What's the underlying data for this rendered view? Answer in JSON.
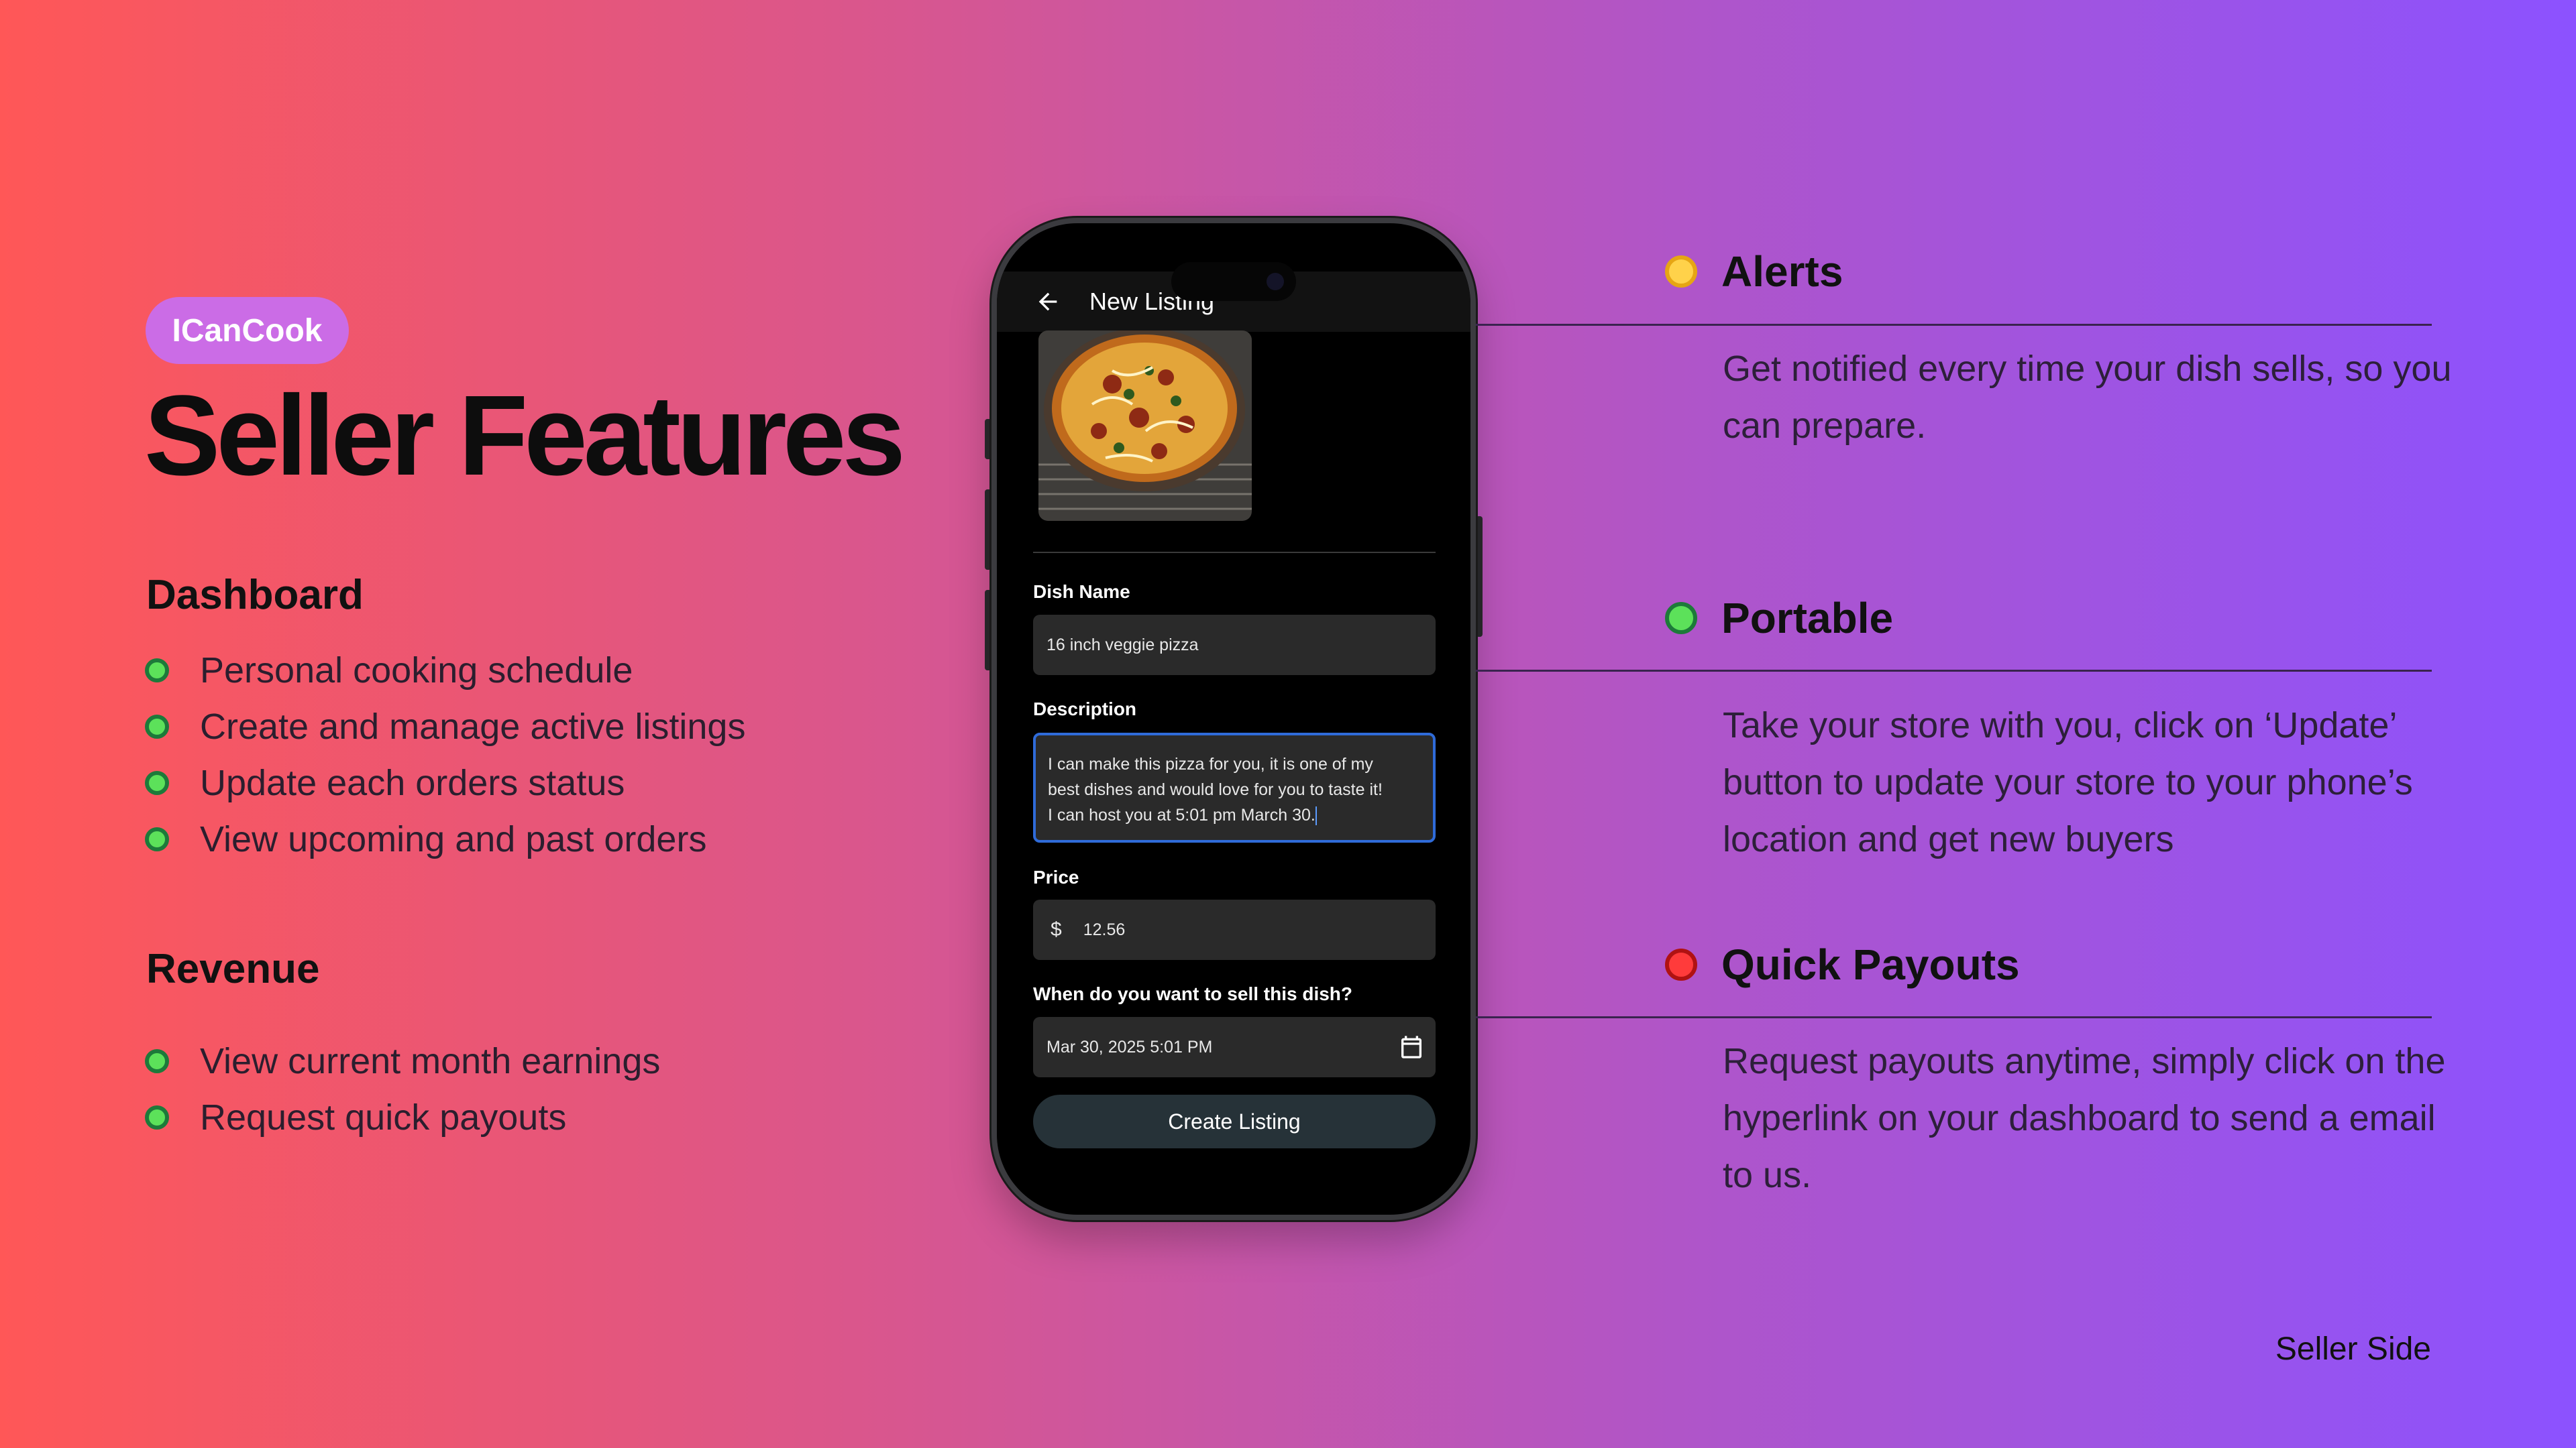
{
  "brand": "ICanCook",
  "title": "Seller Features",
  "dashboard": {
    "heading": "Dashboard",
    "items": [
      "Personal cooking schedule",
      "Create and manage active listings",
      "Update each orders status",
      "View upcoming and past orders"
    ]
  },
  "revenue": {
    "heading": "Revenue",
    "items": [
      "View current month earnings",
      "Request quick payouts"
    ]
  },
  "phone": {
    "appbar_title": "New Listing",
    "dish_name_label": "Dish Name",
    "dish_name_value": "16 inch veggie pizza",
    "description_label": "Description",
    "description_value": "I can make this pizza for you, it is one of my\nbest dishes and would love for you to taste it!\nI can host you at 5:01 pm March 30.",
    "price_label": "Price",
    "currency_symbol": "$",
    "price_value": "12.56",
    "date_label": "When do you want to sell this dish?",
    "date_value": "Mar 30, 2025 5:01 PM",
    "create_button": "Create Listing"
  },
  "features": [
    {
      "title": "Alerts",
      "color": "#ffd24a",
      "description": "Get notified every time your dish sells, so you can prepare."
    },
    {
      "title": "Portable",
      "color": "#5ce15a",
      "description": "Take your store with you, click on ‘Update’ button to update your store to your phone’s location and get new buyers"
    },
    {
      "title": "Quick Payouts",
      "color": "#ff3b3b",
      "description": "Request payouts anytime, simply click on the hyperlink on your dashboard to send a email to us."
    }
  ],
  "footer": "Seller Side"
}
